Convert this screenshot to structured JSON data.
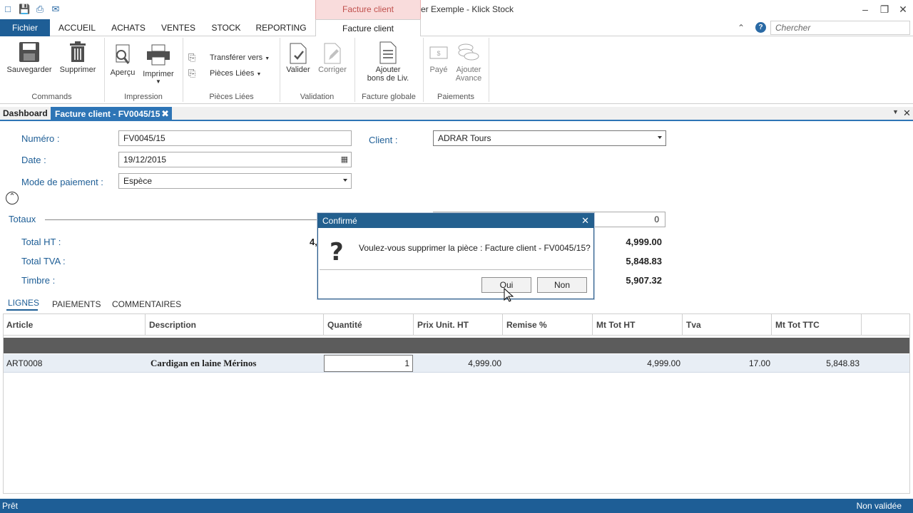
{
  "window": {
    "title": "Dossier Exemple - Klick Stock",
    "context_tab_title": "Facture client"
  },
  "ribbon_tabs": [
    "Fichier",
    "ACCUEIL",
    "ACHATS",
    "VENTES",
    "STOCK",
    "REPORTING",
    "Facture client"
  ],
  "search": {
    "placeholder": "Chercher"
  },
  "ribbon": {
    "commands": {
      "label": "Commands",
      "save": "Sauvegarder",
      "delete": "Supprimer"
    },
    "impression": {
      "label": "Impression",
      "preview": "Aperçu",
      "print": "Imprimer"
    },
    "pieces_liees": {
      "label": "Pièces Liées",
      "transfer": "Transférer vers",
      "linked": "Pièces Liées"
    },
    "validation": {
      "label": "Validation",
      "validate": "Valider",
      "correct": "Corriger"
    },
    "facture_globale": {
      "label": "Facture globale",
      "add_delivery_1": "Ajouter",
      "add_delivery_2": "bons de Liv."
    },
    "paiements": {
      "label": "Paiements",
      "paid": "Payé",
      "advance_1": "Ajouter",
      "advance_2": "Avance"
    }
  },
  "doc_tabs": {
    "dashboard": "Dashboard",
    "current": "Facture client - FV0045/15"
  },
  "form": {
    "numero_label": "Numéro :",
    "numero_value": "FV0045/15",
    "date_label": "Date :",
    "date_value": "19/12/2015",
    "mode_label": "Mode de paiement :",
    "mode_value": "Espèce",
    "client_label": "Client :",
    "client_value": "ADRAR Tours",
    "extra_value": "0"
  },
  "totaux": {
    "title": "Totaux",
    "ht_label": "Total HT :",
    "ht_left_partial": "4,",
    "tva_label": "Total TVA :",
    "timbre_label": "Timbre :",
    "ht_value": "4,999.00",
    "tva_value": "5,848.83",
    "timbre_value": "5,907.32"
  },
  "sub_tabs": [
    "LIGNES",
    "PAIEMENTS",
    "COMMENTAIRES"
  ],
  "grid": {
    "columns": [
      "Article",
      "Description",
      "Quantité",
      "Prix Unit. HT",
      "Remise %",
      "Mt Tot HT",
      "Tva",
      "Mt Tot TTC"
    ],
    "rows": [
      {
        "article": "ART0008",
        "description": "Cardigan en laine Mérinos",
        "quantite": "1",
        "prix": "4,999.00",
        "remise": "",
        "mt_ht": "4,999.00",
        "tva": "17.00",
        "mt_ttc": "5,848.83"
      }
    ]
  },
  "status": {
    "left": "Prêt",
    "right": "Non validée"
  },
  "modal": {
    "title": "Confirmé",
    "message": "Voulez-vous supprimer la pièce : Facture client - FV0045/15?",
    "yes": "Oui",
    "no": "Non"
  },
  "colors": {
    "accent": "#1e5e96",
    "context": "#c0504d",
    "tab_active": "#2e75b6"
  }
}
